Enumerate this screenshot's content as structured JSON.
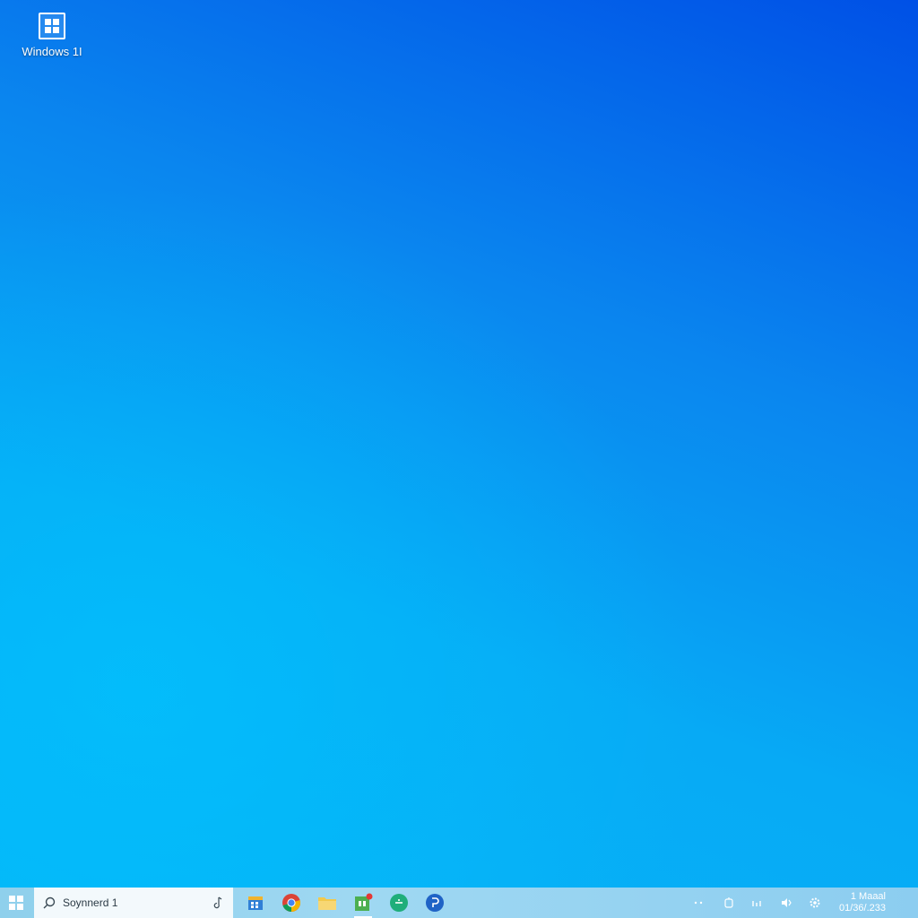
{
  "desktop": {
    "icons": [
      {
        "label": "Windows 1I",
        "icon": "windows-logo-icon"
      }
    ]
  },
  "taskbar": {
    "start_icon": "windows-start-icon",
    "search": {
      "text": "Soynnerd 1",
      "icon": "search-icon",
      "mic_icon": "microphone-icon"
    },
    "pinned": [
      {
        "name": "calendar-app",
        "icon": "calendar-icon"
      },
      {
        "name": "chrome-app",
        "icon": "chrome-icon"
      },
      {
        "name": "file-explorer-app",
        "icon": "folder-icon"
      },
      {
        "name": "store-app",
        "icon": "store-icon"
      },
      {
        "name": "green-app",
        "icon": "circle-app-icon"
      },
      {
        "name": "blue-app",
        "icon": "blue-circle-app-icon"
      }
    ],
    "tray": {
      "date_line1": "1 Maaal",
      "date_line2": "01/36/.233"
    }
  },
  "colors": {
    "wallpaper_top_right": "#0050e6",
    "wallpaper_bottom_left": "#06b4f7",
    "taskbar": "#9fd8f2",
    "search_bg": "#f3f9fc"
  }
}
